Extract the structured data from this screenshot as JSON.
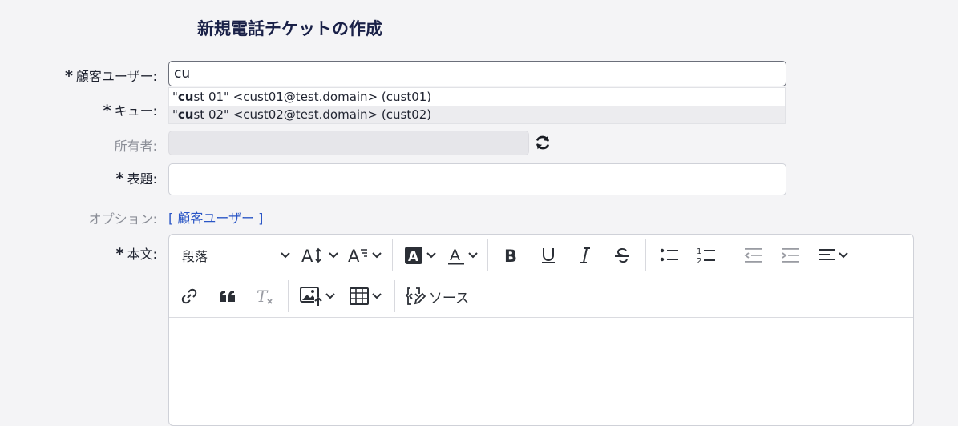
{
  "page": {
    "title": "新規電話チケットの作成"
  },
  "form": {
    "customer_label": "顧客ユーザー:",
    "customer_value": "cu",
    "queue_label": "キュー:",
    "owner_label": "所有者:",
    "subject_label": "表題:",
    "options_label": "オプション:",
    "options_link": "[ 顧客ユーザー ]",
    "body_label": "本文:",
    "required_mark": "*"
  },
  "autocomplete": {
    "items": [
      {
        "match": "cu",
        "prefix": "\"",
        "rest": "st 01\" <cust01@test.domain> (cust01)"
      },
      {
        "match": "cu",
        "prefix": "\"",
        "rest": "st 02\" <cust02@test.domain> (cust02)"
      }
    ]
  },
  "editor": {
    "paragraph_label": "段落",
    "source_label": "ソース"
  },
  "icons": {
    "refresh": "refresh-icon",
    "bold": "bold-icon",
    "italic": "italic-icon"
  },
  "colors": {
    "title": "#1a2148",
    "link": "#2a56c6",
    "muted_label": "#8a8d96"
  }
}
